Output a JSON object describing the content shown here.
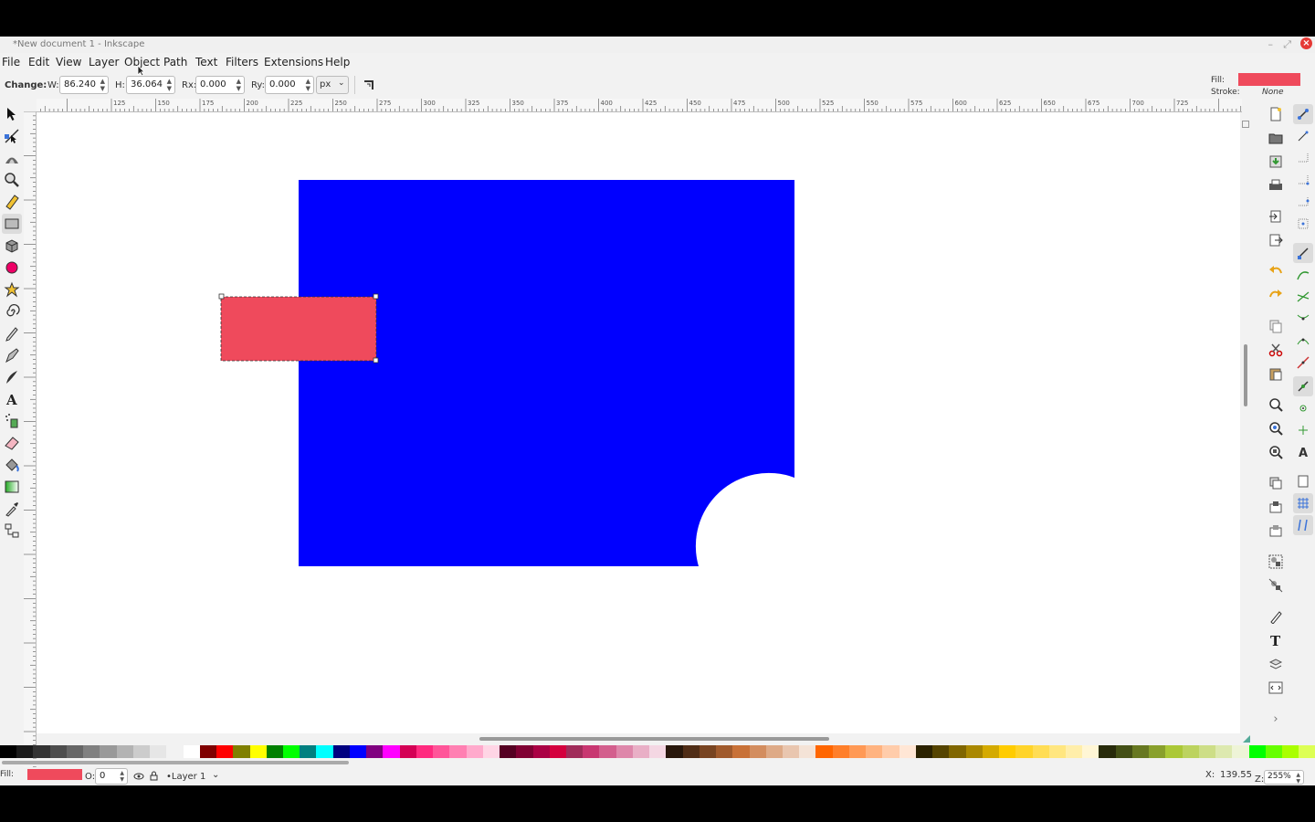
{
  "window": {
    "title": "*New document 1 - Inkscape"
  },
  "menu": [
    "File",
    "Edit",
    "View",
    "Layer",
    "Object",
    "Path",
    "Text",
    "Filters",
    "Extensions",
    "Help"
  ],
  "tool_controls": {
    "change_label": "Change:",
    "w_label": "W:",
    "w_value": "86.240",
    "h_label": "H:",
    "h_value": "36.064",
    "rx_label": "Rx:",
    "rx_value": "0.000",
    "ry_label": "Ry:",
    "ry_value": "0.000",
    "unit": "px"
  },
  "style_indicator": {
    "fill_label": "Fill:",
    "stroke_label": "Stroke:",
    "stroke_value": "None",
    "fill_color": "#ef4a5c"
  },
  "ruler_labels": [
    "125",
    "150",
    "175",
    "200",
    "225",
    "250",
    "275",
    "300",
    "325",
    "350",
    "375",
    "400",
    "425",
    "450",
    "475",
    "500",
    "525",
    "550",
    "575",
    "600",
    "625",
    "650",
    "675",
    "700",
    "725"
  ],
  "canvas": {
    "blue_color": "#0000ff",
    "red_color": "#ef4a5c"
  },
  "status": {
    "fill_label": "Fill:",
    "opacity_label": "O:",
    "opacity_value": "0",
    "layer": "•Layer 1",
    "x_label": "X:",
    "x_value": "139.55",
    "z_label": "Z:",
    "zoom": "255%"
  },
  "palette": [
    "#000000",
    "#1a1a1a",
    "#333333",
    "#4d4d4d",
    "#666666",
    "#808080",
    "#999999",
    "#b3b3b3",
    "#cccccc",
    "#e6e6e6",
    "#f2f2f2",
    "#ffffff",
    "#800000",
    "#ff0000",
    "#808000",
    "#ffff00",
    "#008000",
    "#00ff00",
    "#008080",
    "#00ffff",
    "#000080",
    "#0000ff",
    "#800080",
    "#ff00ff",
    "#d40055",
    "#ff2a7f",
    "#ff5599",
    "#ff80b2",
    "#ffaacc",
    "#ffd5e5",
    "#550022",
    "#800033",
    "#aa0044",
    "#d4003e",
    "#a02c5a",
    "#c83771",
    "#d35f8d",
    "#de87aa",
    "#e9afc6",
    "#f4d7e3",
    "#28170b",
    "#502d16",
    "#784421",
    "#a05a2c",
    "#c87137",
    "#d38d5f",
    "#deaa87",
    "#e9c6af",
    "#f4e3d7",
    "#ff6600",
    "#ff7f2a",
    "#ff9955",
    "#ffb380",
    "#ffccaa",
    "#ffe6d5",
    "#2b2200",
    "#554400",
    "#806600",
    "#aa8800",
    "#d4aa00",
    "#ffcc00",
    "#ffd42a",
    "#ffdd55",
    "#ffe680",
    "#ffeeaa",
    "#fff6d5",
    "#282b0b",
    "#445016",
    "#677821",
    "#89a02c",
    "#abc837",
    "#bcd35f",
    "#cdde87",
    "#dde9af",
    "#eef4d7",
    "#00ff00",
    "#66ff00",
    "#aaff00",
    "#ddff55"
  ]
}
